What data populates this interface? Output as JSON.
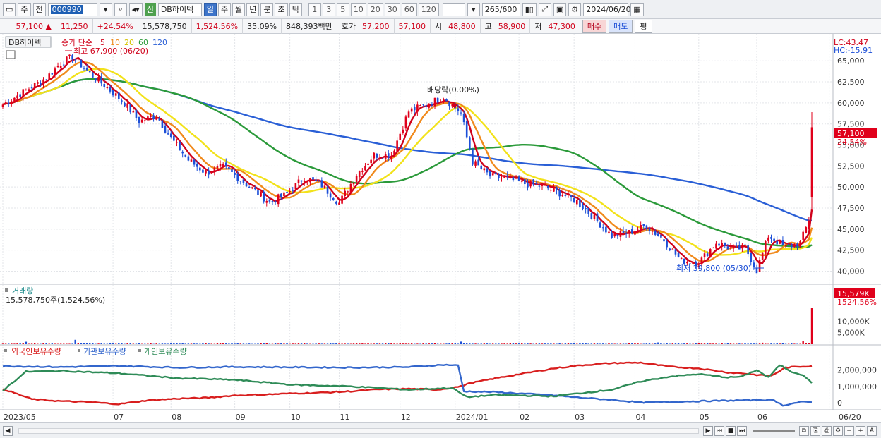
{
  "toolbar": {
    "period_mode": "주",
    "prev_label": "전",
    "stock_code": "000990",
    "stock_tag": "신",
    "stock_name": "DB하이텍",
    "tabs": [
      "일",
      "주",
      "월",
      "년",
      "분",
      "초",
      "틱"
    ],
    "active_tab": "일",
    "intervals": [
      "1",
      "3",
      "5",
      "10",
      "20",
      "30",
      "60",
      "120"
    ],
    "count_current": "265",
    "count_total": "/600",
    "date": "2024/06/20"
  },
  "quote": {
    "price": "57,100",
    "change": "11,250",
    "change_pct": "+24.54%",
    "volume": "15,578,750",
    "volume_ratio": "1,524.56%",
    "turnover": "35.09%",
    "amount": "848,393백만",
    "bid_label": "호가",
    "ask_price": "57,200",
    "bid_price": "57,100",
    "open_label": "시",
    "open": "48,800",
    "high_label": "고",
    "high": "58,900",
    "low_label": "저",
    "low": "47,300",
    "buy_label": "매수",
    "sell_label": "매도",
    "flat_label": "평"
  },
  "colors": {
    "up": "#e0001b",
    "down": "#1c4fd8",
    "ma5": "#d0021b",
    "ma10": "#f08a1c",
    "ma20": "#f2e21a",
    "ma60": "#2b9a3a",
    "ma120": "#2a5fd6",
    "foreign": "#d81e1e",
    "institution": "#3366cc",
    "individual": "#2e8b57"
  },
  "chart_data": [
    {
      "type": "candlestick",
      "title": "DB하이텍",
      "legend": {
        "label": "종가 단순",
        "periods": [
          "5",
          "10",
          "20",
          "60",
          "120"
        ]
      },
      "y_ticks": [
        "65,000",
        "62,500",
        "60,000",
        "57,500",
        "55,000",
        "52,500",
        "50,000",
        "47,500",
        "45,000",
        "42,500",
        "40,000"
      ],
      "ylim": [
        38700,
        67700
      ],
      "lc_label": "LC:43.47",
      "hc_label": "HC:-15.91",
      "high_note": "최고 67,900 (06/20)",
      "low_note": "최저 39,800 (05/30)",
      "dividend_note": "배당락(0.00%)",
      "last_price_label": "57,100",
      "last_pct_label": "24.54%",
      "anchors": [
        [
          0,
          59800
        ],
        [
          8,
          61500
        ],
        [
          15,
          63000
        ],
        [
          20,
          64700
        ],
        [
          24,
          65500
        ],
        [
          30,
          63500
        ],
        [
          36,
          61800
        ],
        [
          42,
          60000
        ],
        [
          47,
          57800
        ],
        [
          53,
          58500
        ],
        [
          58,
          55800
        ],
        [
          64,
          53200
        ],
        [
          70,
          51700
        ],
        [
          76,
          52400
        ],
        [
          80,
          51400
        ],
        [
          86,
          49800
        ],
        [
          92,
          48200
        ],
        [
          98,
          49200
        ],
        [
          104,
          51200
        ],
        [
          110,
          50200
        ],
        [
          116,
          48100
        ],
        [
          122,
          51500
        ],
        [
          128,
          53800
        ],
        [
          134,
          53800
        ],
        [
          140,
          59000
        ],
        [
          146,
          59800
        ],
        [
          152,
          60700
        ],
        [
          158,
          58800
        ],
        [
          162,
          53000
        ],
        [
          168,
          51300
        ],
        [
          174,
          51000
        ],
        [
          180,
          50400
        ],
        [
          186,
          50100
        ],
        [
          192,
          49300
        ],
        [
          198,
          48300
        ],
        [
          204,
          46300
        ],
        [
          210,
          44200
        ],
        [
          216,
          44600
        ],
        [
          222,
          45400
        ],
        [
          228,
          43700
        ],
        [
          234,
          41200
        ],
        [
          240,
          41000
        ],
        [
          246,
          43400
        ],
        [
          252,
          42600
        ],
        [
          256,
          42800
        ],
        [
          260,
          40100
        ],
        [
          264,
          44200
        ],
        [
          270,
          42800
        ],
        [
          275,
          43400
        ],
        [
          278,
          46000
        ],
        [
          279,
          57100
        ]
      ],
      "n_bars": 280
    },
    {
      "type": "bar",
      "title": "거래량",
      "summary": "15,578,750주(1,524.56%)",
      "y_ticks": [
        "10,000K",
        "5,000K"
      ],
      "last_label": "15,579K",
      "last_pct_label": "1524.56%",
      "spikes": [
        [
          8,
          1050000
        ],
        [
          25,
          1900000
        ],
        [
          43,
          600000
        ],
        [
          60,
          500000
        ],
        [
          158,
          1100000
        ],
        [
          226,
          750000
        ],
        [
          262,
          650000
        ],
        [
          276,
          1300000
        ],
        [
          279,
          15578750
        ]
      ],
      "ylim": [
        0,
        16500000
      ]
    },
    {
      "type": "line",
      "series": [
        {
          "name": "외국인보유수량",
          "key": "foreign",
          "anchors": [
            [
              0,
              850000
            ],
            [
              10,
              220000
            ],
            [
              20,
              100000
            ],
            [
              30,
              40000
            ],
            [
              40,
              -80000
            ],
            [
              50,
              150000
            ],
            [
              60,
              250000
            ],
            [
              70,
              300000
            ],
            [
              80,
              450000
            ],
            [
              90,
              500000
            ],
            [
              100,
              570000
            ],
            [
              110,
              620000
            ],
            [
              120,
              700000
            ],
            [
              130,
              820000
            ],
            [
              140,
              850000
            ],
            [
              150,
              800000
            ],
            [
              158,
              1000000
            ],
            [
              160,
              1150000
            ],
            [
              170,
              1500000
            ],
            [
              180,
              1800000
            ],
            [
              190,
              2100000
            ],
            [
              200,
              2300000
            ],
            [
              210,
              2420000
            ],
            [
              220,
              2450000
            ],
            [
              230,
              2200000
            ],
            [
              240,
              2100000
            ],
            [
              250,
              1850000
            ],
            [
              255,
              1800000
            ],
            [
              260,
              1700000
            ],
            [
              265,
              1650000
            ],
            [
              270,
              2150000
            ],
            [
              279,
              2250000
            ]
          ]
        },
        {
          "name": "기관보유수량",
          "key": "institution",
          "anchors": [
            [
              0,
              2240000
            ],
            [
              20,
              2180000
            ],
            [
              40,
              2250000
            ],
            [
              60,
              2150000
            ],
            [
              80,
              2190000
            ],
            [
              100,
              2170000
            ],
            [
              120,
              2150000
            ],
            [
              140,
              2180000
            ],
            [
              152,
              2320000
            ],
            [
              157,
              2280000
            ],
            [
              159,
              700000
            ],
            [
              170,
              650000
            ],
            [
              180,
              550000
            ],
            [
              190,
              450000
            ],
            [
              200,
              300000
            ],
            [
              210,
              180000
            ],
            [
              220,
              20000
            ],
            [
              230,
              50000
            ],
            [
              240,
              100000
            ],
            [
              250,
              130000
            ],
            [
              262,
              180000
            ],
            [
              266,
              150000
            ],
            [
              269,
              -160000
            ],
            [
              275,
              50000
            ],
            [
              279,
              30000
            ]
          ]
        },
        {
          "name": "개인보유수량",
          "key": "individual",
          "anchors": [
            [
              0,
              750000
            ],
            [
              8,
              1900000
            ],
            [
              20,
              1950000
            ],
            [
              40,
              1800000
            ],
            [
              60,
              1500000
            ],
            [
              80,
              1400000
            ],
            [
              100,
              1100000
            ],
            [
              120,
              1000000
            ],
            [
              140,
              800000
            ],
            [
              155,
              900000
            ],
            [
              160,
              350000
            ],
            [
              170,
              480000
            ],
            [
              190,
              400000
            ],
            [
              210,
              800000
            ],
            [
              220,
              1300000
            ],
            [
              230,
              1600000
            ],
            [
              240,
              1750000
            ],
            [
              250,
              1550000
            ],
            [
              255,
              1600000
            ],
            [
              260,
              2000000
            ],
            [
              264,
              1550000
            ],
            [
              268,
              2300000
            ],
            [
              272,
              1900000
            ],
            [
              276,
              1700000
            ],
            [
              279,
              1200000
            ]
          ]
        }
      ],
      "y_ticks": [
        "2,000,000",
        "1,000,000",
        "0"
      ],
      "ylim": [
        -300000,
        2800000
      ]
    }
  ],
  "x_axis": {
    "labels": [
      {
        "text": "2023/05",
        "bar": 0
      },
      {
        "text": "07",
        "bar": 38
      },
      {
        "text": "08",
        "bar": 58
      },
      {
        "text": "09",
        "bar": 80
      },
      {
        "text": "10",
        "bar": 99
      },
      {
        "text": "11",
        "bar": 116
      },
      {
        "text": "12",
        "bar": 137
      },
      {
        "text": "2024/01",
        "bar": 156
      },
      {
        "text": "02",
        "bar": 178
      },
      {
        "text": "03",
        "bar": 197
      },
      {
        "text": "04",
        "bar": 218
      },
      {
        "text": "05",
        "bar": 240
      },
      {
        "text": "06",
        "bar": 260
      },
      {
        "text": "06/20",
        "bar": 285
      }
    ]
  }
}
